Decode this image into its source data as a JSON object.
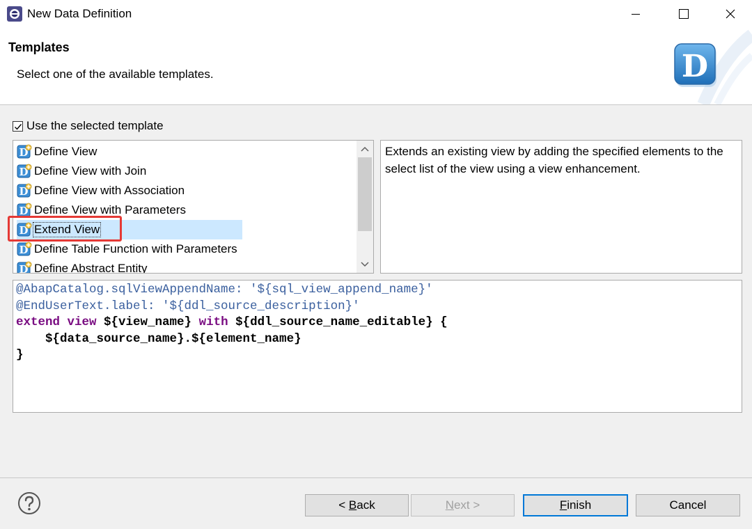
{
  "window": {
    "title": "New Data Definition",
    "controls": [
      "minimize-icon",
      "maximize-icon",
      "close-icon"
    ]
  },
  "header": {
    "title": "Templates",
    "subtitle": "Select one of the available templates.",
    "logo_letter": "D"
  },
  "use_template": {
    "label": "Use the selected template",
    "checked": true
  },
  "templates": {
    "selected_index": 4,
    "items": [
      {
        "label": "Define View"
      },
      {
        "label": "Define View with Join"
      },
      {
        "label": "Define View with Association"
      },
      {
        "label": "Define View with Parameters"
      },
      {
        "label": "Extend View"
      },
      {
        "label": "Define Table Function with Parameters"
      },
      {
        "label": "Define Abstract Entity"
      }
    ]
  },
  "description": "Extends an existing view by adding the specified elements to the select list of the view using a view enhancement.",
  "code": {
    "line1_ann": "@AbapCatalog.sqlViewAppendName: '${sql_view_append_name}'",
    "line2_ann": "@EndUserText.label: '${ddl_source_description}'",
    "line3_kw1": "extend view",
    "line3_t1": " ${view_name} ",
    "line3_kw2": "with",
    "line3_t2": " ${ddl_source_name_editable} {",
    "line4": "    ${data_source_name}.${element_name}",
    "line5": "}"
  },
  "buttons": {
    "back": {
      "prefix": "< ",
      "mnemonic": "B",
      "rest": "ack",
      "enabled": true
    },
    "next": {
      "mnemonic": "N",
      "rest": "ext >",
      "enabled": false
    },
    "finish": {
      "mnemonic": "F",
      "rest": "inish",
      "enabled": true,
      "default": true
    },
    "cancel": {
      "label": "Cancel",
      "enabled": true
    }
  },
  "colors": {
    "selection": "#cce8ff",
    "highlight": "#e53935",
    "annotation": "#3a5f9e",
    "keyword": "#7a0d82",
    "default_button_border": "#0078d7"
  }
}
